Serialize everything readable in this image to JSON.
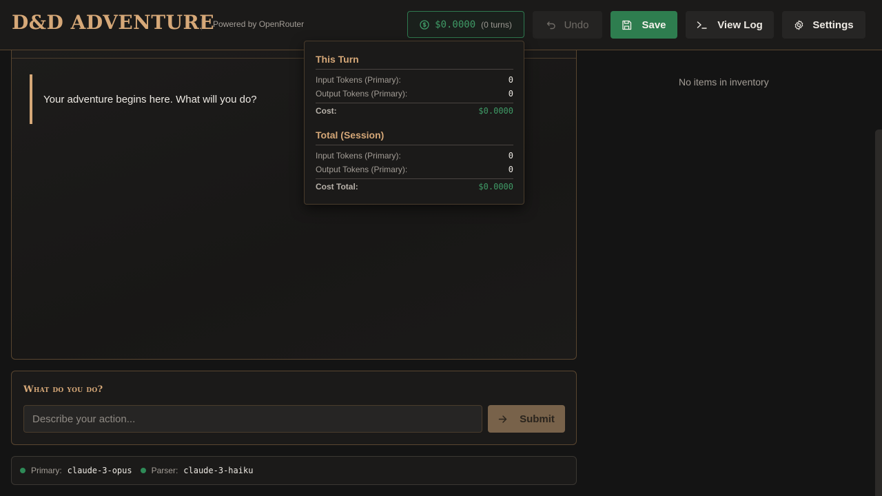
{
  "header": {
    "logo": "D&D ADVENTURE",
    "powered_by": "Powered by OpenRouter",
    "cost_value": "$0.0000",
    "cost_turns": "(0 turns)",
    "undo_label": "Undo",
    "save_label": "Save",
    "view_log_label": "View Log",
    "settings_label": "Settings"
  },
  "story": {
    "message": "Your adventure begins here. What will you do?"
  },
  "action": {
    "title": "What do you do?",
    "placeholder": "Describe your action...",
    "submit_label": "Submit"
  },
  "status": {
    "primary_label": "Primary:",
    "primary_model": "claude-3-opus",
    "parser_label": "Parser:",
    "parser_model": "claude-3-haiku"
  },
  "inventory": {
    "empty_text": "No items in inventory"
  },
  "cost_popover": {
    "this_turn_title": "This Turn",
    "this_turn": {
      "input_label": "Input Tokens (Primary):",
      "input_value": "0",
      "output_label": "Output Tokens (Primary):",
      "output_value": "0",
      "cost_label": "Cost:",
      "cost_value": "$0.0000"
    },
    "total_title": "Total (Session)",
    "total": {
      "input_label": "Input Tokens (Primary):",
      "input_value": "0",
      "output_label": "Output Tokens (Primary):",
      "output_value": "0",
      "cost_label": "Cost Total:",
      "cost_value": "$0.0000"
    }
  },
  "colors": {
    "accent_gold": "#d6a878",
    "success_green": "#2e7d4f",
    "cost_green": "#3f9a66",
    "background": "#141414"
  },
  "icons": {
    "cost": "dollar-circle-icon",
    "undo": "undo-arrow-icon",
    "save": "floppy-disk-icon",
    "log": "terminal-prompt-icon",
    "settings": "gear-icon",
    "submit": "arrow-right-icon",
    "status": "status-dot-icon"
  }
}
